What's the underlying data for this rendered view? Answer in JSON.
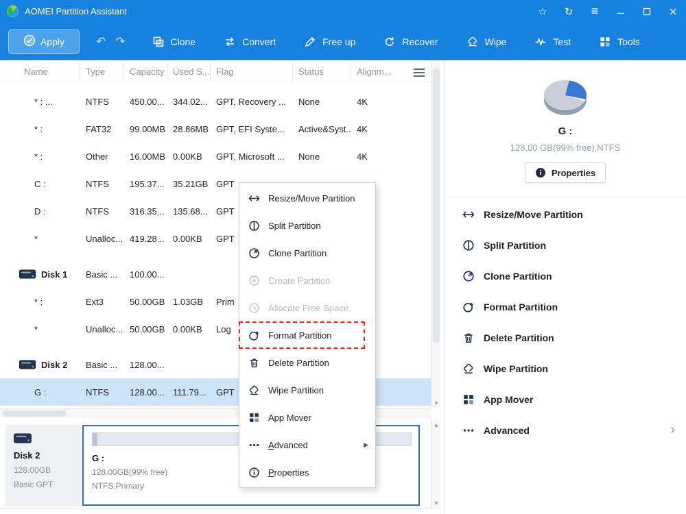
{
  "window": {
    "title": "AOMEI Partition Assistant"
  },
  "icons": {
    "star": "☆",
    "sync": "↻",
    "menu": "≡",
    "undo": "↶",
    "redo": "↷",
    "submenu_arrow": "▶",
    "chevron_right": "›",
    "scroll_up": "▴",
    "scroll_down": "▾"
  },
  "toolbar": {
    "apply_label": "Apply",
    "buttons": [
      {
        "label": "Clone"
      },
      {
        "label": "Convert"
      },
      {
        "label": "Free up"
      },
      {
        "label": "Recover"
      },
      {
        "label": "Wipe"
      },
      {
        "label": "Test"
      },
      {
        "label": "Tools"
      }
    ]
  },
  "table": {
    "columns": [
      "Name",
      "Type",
      "Capacity",
      "Used S...",
      "Flag",
      "Status",
      "Alignm..."
    ],
    "rows": [
      {
        "name": "* : ...",
        "type": "NTFS",
        "capacity": "450.00...",
        "used": "344.02...",
        "flag": "GPT, Recovery ...",
        "status": "None",
        "align": "4K"
      },
      {
        "name": "* :",
        "type": "FAT32",
        "capacity": "99.00MB",
        "used": "28.86MB",
        "flag": "GPT, EFI Syste...",
        "status": "Active&Syst...",
        "align": "4K"
      },
      {
        "name": "* :",
        "type": "Other",
        "capacity": "16.00MB",
        "used": "0.00KB",
        "flag": "GPT, Microsoft ...",
        "status": "None",
        "align": "4K"
      },
      {
        "name": "C :",
        "type": "NTFS",
        "capacity": "195.37...",
        "used": "35.21GB",
        "flag": "GPT",
        "status": "",
        "align": ""
      },
      {
        "name": "D :",
        "type": "NTFS",
        "capacity": "316.35...",
        "used": "135.68...",
        "flag": "GPT",
        "status": "",
        "align": ""
      },
      {
        "name": "*",
        "type": "Unalloc...",
        "capacity": "419.28...",
        "used": "0.00KB",
        "flag": "GPT",
        "status": "",
        "align": ""
      },
      {
        "name": "Disk 1",
        "type": "Basic ...",
        "capacity": "100.00...",
        "used": "",
        "flag": "",
        "status": "",
        "align": ""
      },
      {
        "name": "* :",
        "type": "Ext3",
        "capacity": "50.00GB",
        "used": "1.03GB",
        "flag": "Prim",
        "status": "",
        "align": ""
      },
      {
        "name": "*",
        "type": "Unalloc...",
        "capacity": "50.00GB",
        "used": "0.00KB",
        "flag": "Log",
        "status": "",
        "align": ""
      },
      {
        "name": "Disk 2",
        "type": "Basic ...",
        "capacity": "128.00...",
        "used": "",
        "flag": "",
        "status": "",
        "align": ""
      },
      {
        "name": "G :",
        "type": "NTFS",
        "capacity": "128.00...",
        "used": "111.79...",
        "flag": "GPT",
        "status": "",
        "align": ""
      }
    ]
  },
  "context_menu": {
    "items": [
      {
        "label": "Resize/Move Partition"
      },
      {
        "label": "Split Partition"
      },
      {
        "label": "Clone Partition"
      },
      {
        "label": "Create Partition"
      },
      {
        "label": "Allocate Free Space"
      },
      {
        "label": "Format Partition"
      },
      {
        "label": "Delete Partition"
      },
      {
        "label": "Wipe Partition"
      },
      {
        "label": "App Mover"
      },
      {
        "label": "Advanced"
      },
      {
        "label": "Properties"
      }
    ]
  },
  "bottom_panel": {
    "disk_name": "Disk 2",
    "disk_capacity": "128.00GB",
    "disk_type": "Basic GPT",
    "partition_name": "G :",
    "partition_capacity": "128.00GB(99% free)",
    "partition_fs": "NTFS,Primary"
  },
  "sidebar": {
    "partition_name": "G :",
    "partition_info": "128.00 GB(99% free),NTFS",
    "properties_label": "Properties",
    "actions": [
      {
        "label": "Resize/Move Partition"
      },
      {
        "label": "Split Partition"
      },
      {
        "label": "Clone Partition"
      },
      {
        "label": "Format Partition"
      },
      {
        "label": "Delete Partition"
      },
      {
        "label": "Wipe Partition"
      },
      {
        "label": "App Mover"
      },
      {
        "label": "Advanced"
      }
    ]
  },
  "colors": {
    "titlebar_blue": "#1781e0",
    "selected_row": "#cde4f8",
    "selection_border": "#2f6bbf",
    "highlight_dashed_red": "#e1251b"
  }
}
